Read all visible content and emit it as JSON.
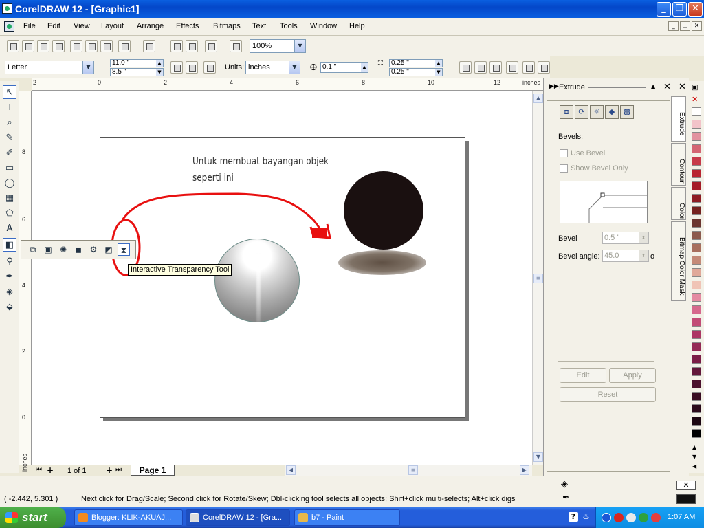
{
  "window": {
    "title": "CorelDRAW 12 - [Graphic1]"
  },
  "menu": [
    "File",
    "Edit",
    "View",
    "Layout",
    "Arrange",
    "Effects",
    "Bitmaps",
    "Text",
    "Tools",
    "Window",
    "Help"
  ],
  "toolbar": {
    "zoom": "100%"
  },
  "property_bar": {
    "paper": "Letter",
    "width": "11.0 \"",
    "height": "8.5 \"",
    "units_label": "Units:",
    "units": "inches",
    "nudge": "0.1 \"",
    "dup_x": "0.25 \"",
    "dup_y": "0.25 \""
  },
  "rulers": {
    "top": [
      "2",
      "0",
      "2",
      "4",
      "6",
      "8",
      "10",
      "12"
    ],
    "top_unit": "inches",
    "left": [
      "8",
      "6",
      "4",
      "2",
      "0"
    ],
    "left_unit": "inches"
  },
  "canvas": {
    "note": "Untuk membuat bayangan objek seperti ini"
  },
  "flyout": {
    "tooltip": "Interactive Transparency Tool"
  },
  "pages": {
    "counter": "1 of 1",
    "tab": "Page 1"
  },
  "docker": {
    "title": "Extrude",
    "bevels_label": "Bevels:",
    "use_bevel": "Use Bevel",
    "show_bevel_only": "Show Bevel Only",
    "bevel_label": "Bevel",
    "bevel_value": "0.5 \"",
    "bevel_angle_label": "Bevel angle:",
    "bevel_angle_value": "45.0",
    "degree": "o",
    "edit": "Edit",
    "apply": "Apply",
    "reset": "Reset"
  },
  "side_tabs": [
    "Extrude",
    "Contour",
    "Color",
    "Bitmap Color Mask"
  ],
  "palette": [
    "#ffffff",
    "#f2c3c9",
    "#e2929f",
    "#d46573",
    "#c73a4a",
    "#b92431",
    "#a51c28",
    "#8e1c24",
    "#75211f",
    "#6b3530",
    "#8c5a4e",
    "#a86f5e",
    "#c48a78",
    "#e0a899",
    "#f0c4b6",
    "#e48aa2",
    "#d6688d",
    "#c24c77",
    "#ad3665",
    "#942a56",
    "#7b1d47",
    "#62173a",
    "#4c112e",
    "#3a0d23",
    "#2b0a1b",
    "#1c0712",
    "#000000"
  ],
  "status": {
    "coords": "( -2.442, 5.301 )",
    "hint": "Next click for Drag/Scale; Second click for Rotate/Skew; Dbl-clicking tool selects all objects; Shift+click multi-selects; Alt+click digs"
  },
  "taskbar": {
    "start": "start",
    "tasks": [
      "Blogger: KLIK-AKUAJ...",
      "CorelDRAW 12 - [Gra...",
      "b7 - Paint"
    ],
    "clock": "1:07 AM"
  }
}
